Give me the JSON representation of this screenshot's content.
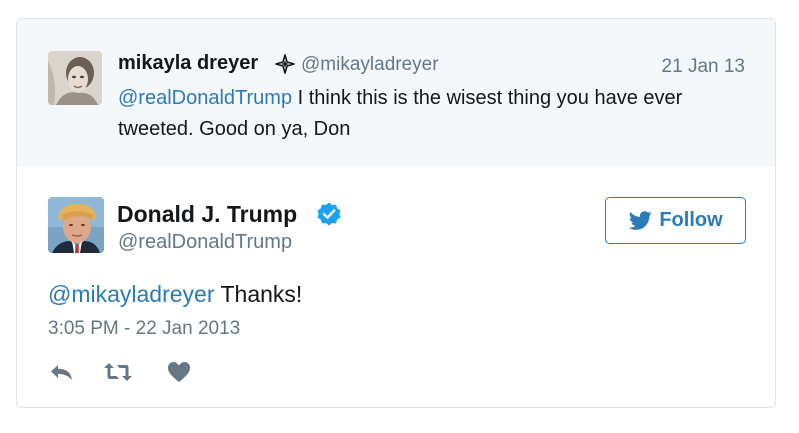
{
  "parent_tweet": {
    "display_name": "mikayla dreyer",
    "badge_icon": "sparkle-badge-icon",
    "handle": "@mikayladreyer",
    "date": "21 Jan 13",
    "mention": "@realDonaldTrump",
    "text": " I think this is the wisest thing you have ever tweeted. Good on ya, Don"
  },
  "main_tweet": {
    "display_name": "Donald J. Trump",
    "verified_icon": "verified-badge-icon",
    "handle": "@realDonaldTrump",
    "follow_label": "Follow",
    "mention": "@mikayladreyer",
    "text": " Thanks!",
    "timestamp": "3:05 PM - 22 Jan 2013"
  },
  "actions": [
    "reply-icon",
    "retweet-icon",
    "like-icon"
  ],
  "colors": {
    "accent": "#2b7bb9",
    "text": "#14171a",
    "muted": "#657786",
    "parent_bg": "#f5f8fa",
    "border": "#dfe3e8",
    "verified": "#1da1f2"
  }
}
